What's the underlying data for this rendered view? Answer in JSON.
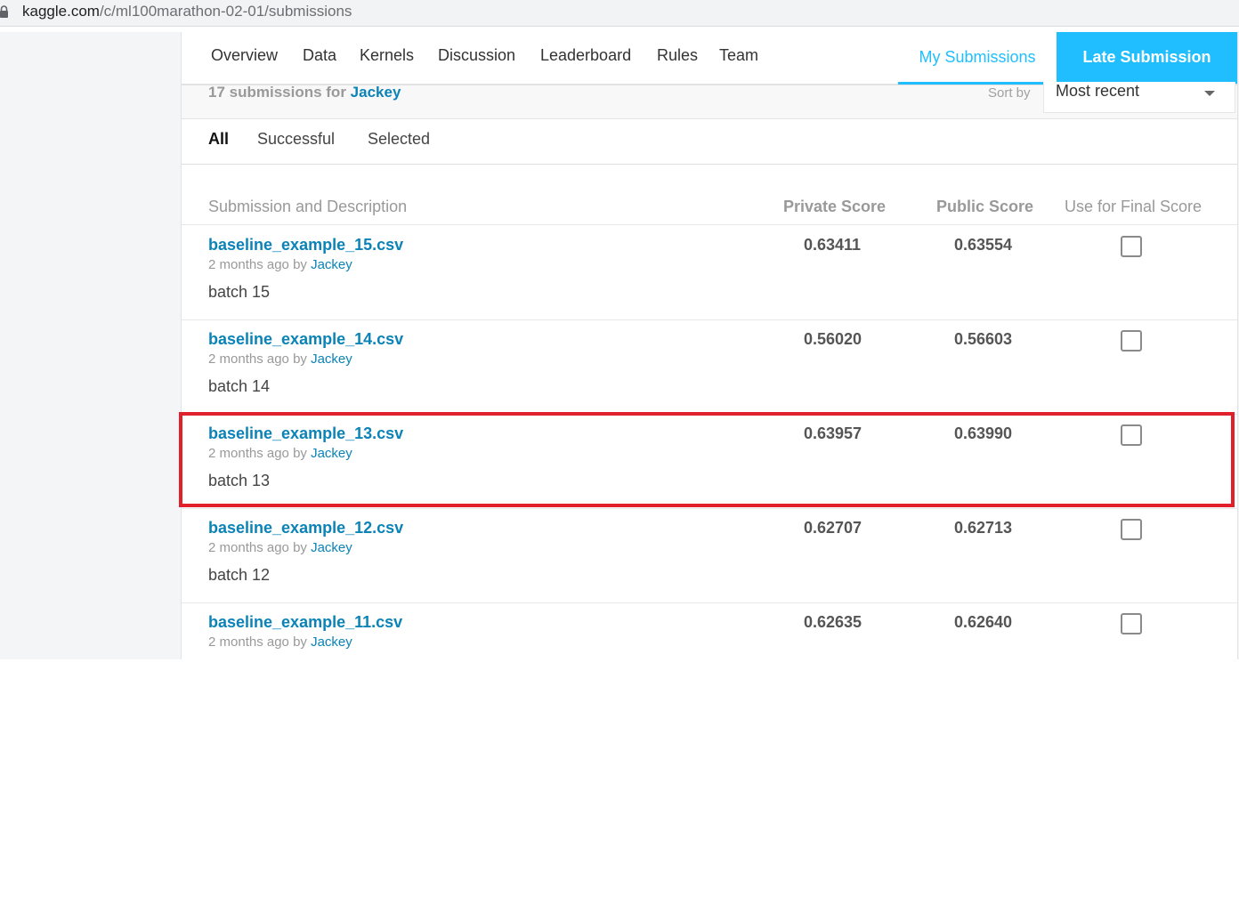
{
  "browser": {
    "url_domain": "kaggle.com",
    "url_path": "/c/ml100marathon-02-01/submissions"
  },
  "nav": {
    "tabs": [
      "Overview",
      "Data",
      "Kernels",
      "Discussion",
      "Leaderboard",
      "Rules",
      "Team"
    ],
    "my_submissions": "My Submissions",
    "late_submission": "Late Submission",
    "accent_color": "#20beff"
  },
  "summary": {
    "count_text": "17 submissions for",
    "user": "Jackey",
    "sort_label": "Sort by",
    "sort_value": "Most recent"
  },
  "filters": {
    "all": "All",
    "successful": "Successful",
    "selected": "Selected"
  },
  "table": {
    "headers": {
      "submission": "Submission and Description",
      "private": "Private Score",
      "public": "Public Score",
      "final": "Use for Final Score"
    },
    "rows": [
      {
        "file": "baseline_example_15.csv",
        "time": "2 months ago",
        "by": "by",
        "user": "Jackey",
        "description": "batch 15",
        "private": "0.63411",
        "public": "0.63554",
        "selected": false
      },
      {
        "file": "baseline_example_14.csv",
        "time": "2 months ago",
        "by": "by",
        "user": "Jackey",
        "description": "batch 14",
        "private": "0.56020",
        "public": "0.56603",
        "selected": false
      },
      {
        "file": "baseline_example_13.csv",
        "time": "2 months ago",
        "by": "by",
        "user": "Jackey",
        "description": "batch 13",
        "private": "0.63957",
        "public": "0.63990",
        "selected": false
      },
      {
        "file": "baseline_example_12.csv",
        "time": "2 months ago",
        "by": "by",
        "user": "Jackey",
        "description": "batch 12",
        "private": "0.62707",
        "public": "0.62713",
        "selected": false
      },
      {
        "file": "baseline_example_11.csv",
        "time": "2 months ago",
        "by": "by",
        "user": "Jackey",
        "description": "",
        "private": "0.62635",
        "public": "0.62640",
        "selected": false
      }
    ]
  },
  "highlight": {
    "color": "#e0202a",
    "row_index": 2
  }
}
